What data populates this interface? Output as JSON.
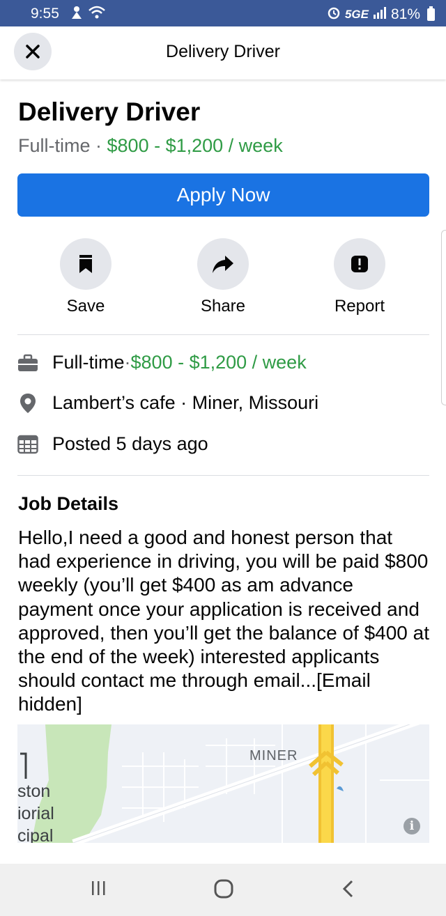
{
  "status_bar": {
    "time": "9:55",
    "network": "5GE",
    "battery": "81%"
  },
  "header": {
    "title": "Delivery Driver",
    "close_icon": "close-icon"
  },
  "job": {
    "title": "Delivery Driver",
    "type": "Full-time",
    "separator": " · ",
    "salary": "$800 - $1,200 / week",
    "apply_label": "Apply Now"
  },
  "actions": [
    {
      "label": "Save",
      "icon": "bookmark-icon"
    },
    {
      "label": "Share",
      "icon": "share-arrow-icon"
    },
    {
      "label": "Report",
      "icon": "report-icon"
    }
  ],
  "info": {
    "type": "Full-time",
    "salary": "$800 - $1,200 / week",
    "location": "Lambert’s cafe · Miner, Missouri",
    "posted": "Posted 5 days ago"
  },
  "details": {
    "heading": "Job Details",
    "body": "Hello,I need a good and honest person that had experience in driving, you will be paid $800 weekly (you’ll get $400 as am advance payment once your application is received and approved, then you’ll get the balance of $400 at the end of the week) interested applicants should contact me through email...[Email hidden]"
  },
  "map": {
    "label_town": "MINER",
    "label_left_1": "ston",
    "label_left_2": "iorial",
    "label_left_3": "cipal",
    "info_icon": "info-icon"
  },
  "colors": {
    "status_bar": "#3b5998",
    "accent": "#1a73e3",
    "salary": "#2f9b45"
  }
}
